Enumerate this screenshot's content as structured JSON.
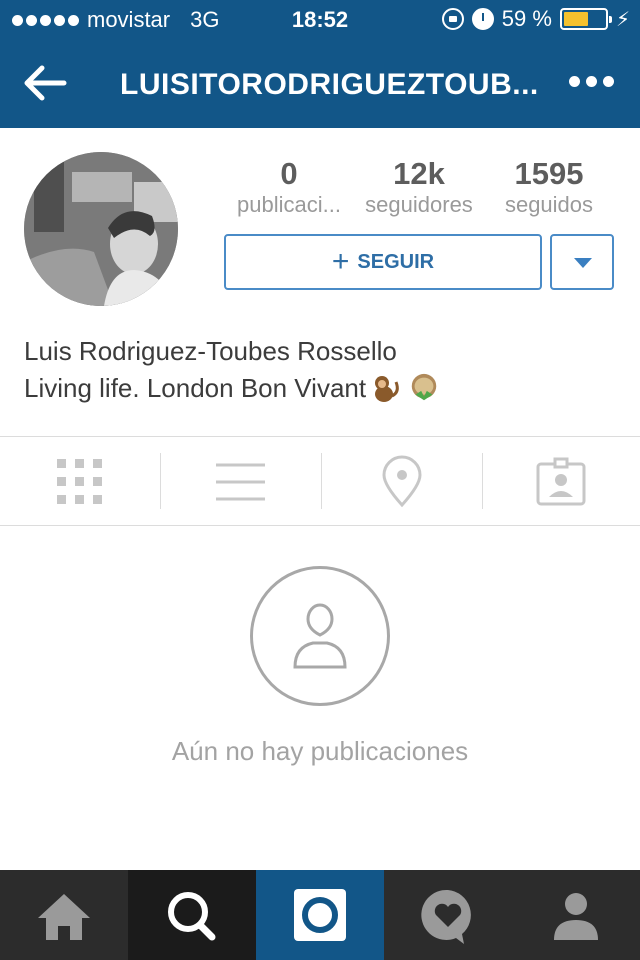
{
  "status_bar": {
    "carrier": "movistar",
    "network": "3G",
    "time": "18:52",
    "battery_text": "59 %",
    "battery_level": 0.59,
    "battery_color": "#f5c12e",
    "icons": [
      "signal-dots-icon",
      "rotation-lock-icon",
      "alarm-icon",
      "battery-icon",
      "charging-bolt-icon"
    ]
  },
  "nav": {
    "title": "LUISITORODRIGUEZTOUB...",
    "back_icon": "back-arrow-icon",
    "more_icon": "more-options-icon",
    "bar_color": "#125688"
  },
  "profile": {
    "stats": [
      {
        "num": "0",
        "label": "publicaci..."
      },
      {
        "num": "12k",
        "label": "seguidores"
      },
      {
        "num": "1595",
        "label": "seguidos"
      }
    ],
    "follow_label": "SEGUIR",
    "follow_icon": "plus-icon",
    "dropdown_icon": "caret-down-icon",
    "full_name": "Luis Rodriguez-Toubes Rossello",
    "bio": "Living life. London Bon Vivant",
    "bio_emojis": [
      "monkey-emoji",
      "chestnut-emoji"
    ]
  },
  "tabs": [
    "grid-icon",
    "list-icon",
    "location-pin-icon",
    "tagged-photos-icon"
  ],
  "empty_state": {
    "icon": "person-outline-icon",
    "text": "Aún no hay publicaciones"
  },
  "tabbar": {
    "items": [
      "home-icon",
      "search-icon",
      "camera-icon",
      "activity-heart-icon",
      "profile-icon"
    ],
    "active": "search-icon",
    "accent": "#125688"
  }
}
